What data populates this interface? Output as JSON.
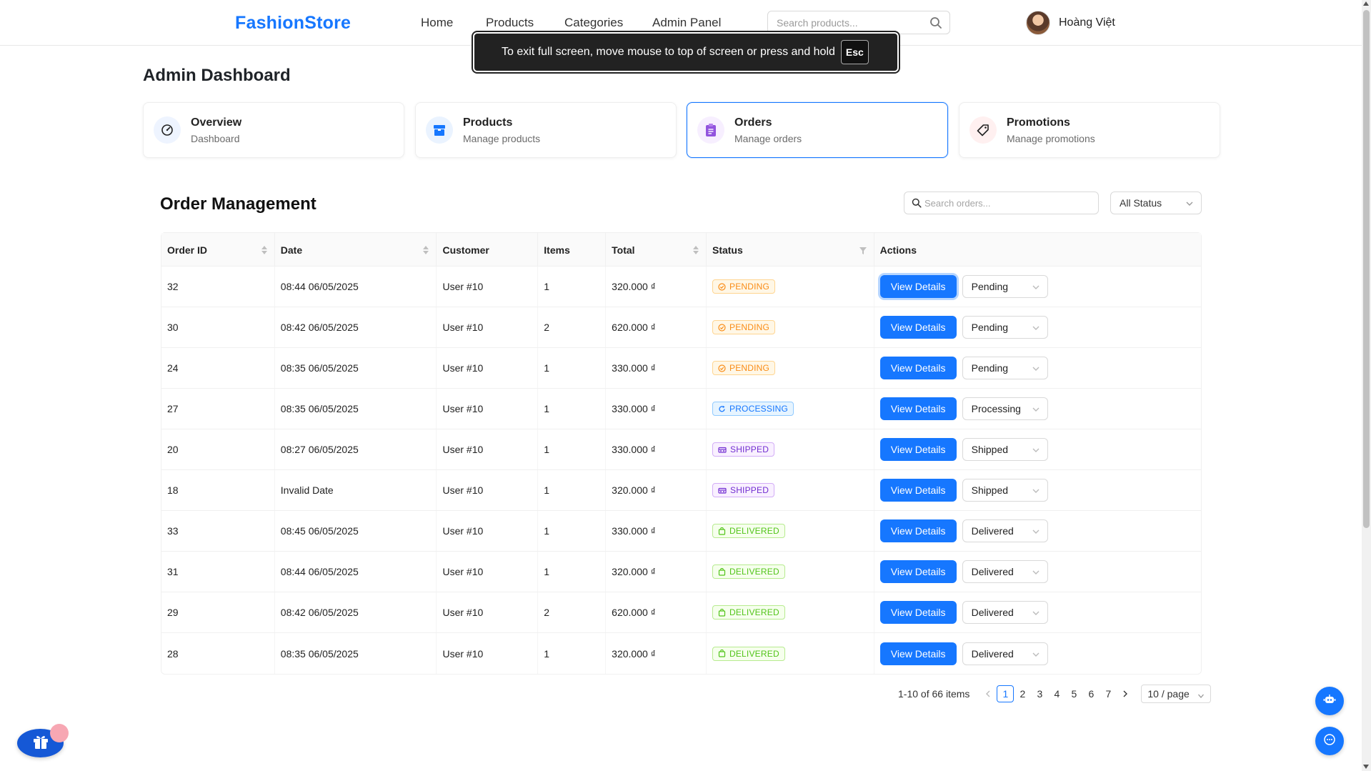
{
  "header": {
    "brand": "FashionStore",
    "nav": [
      "Home",
      "Products",
      "Categories",
      "Admin Panel"
    ],
    "search_placeholder": "Search products...",
    "user_name": "Hoàng Việt"
  },
  "fullscreen_toast": {
    "message": "To exit full screen, move mouse to top of screen or press and hold",
    "key": "Esc"
  },
  "page_title": "Admin Dashboard",
  "cards": [
    {
      "title": "Overview",
      "subtitle": "Dashboard",
      "icon": "dashboard-icon"
    },
    {
      "title": "Products",
      "subtitle": "Manage products",
      "icon": "box-icon"
    },
    {
      "title": "Orders",
      "subtitle": "Manage orders",
      "icon": "clipboard-icon",
      "active": true
    },
    {
      "title": "Promotions",
      "subtitle": "Manage promotions",
      "icon": "tag-icon"
    }
  ],
  "order_management": {
    "title": "Order Management",
    "search_placeholder": "Search orders...",
    "status_filter": "All Status",
    "columns": [
      "Order ID",
      "Date",
      "Customer",
      "Items",
      "Total",
      "Status",
      "Actions"
    ],
    "view_label": "View Details",
    "rows": [
      {
        "id": "32",
        "date": "08:44 06/05/2025",
        "customer": "User #10",
        "items": "1",
        "total": "320.000 ₫",
        "status": "PENDING",
        "status_key": "pending",
        "select": "Pending"
      },
      {
        "id": "30",
        "date": "08:42 06/05/2025",
        "customer": "User #10",
        "items": "2",
        "total": "620.000 ₫",
        "status": "PENDING",
        "status_key": "pending",
        "select": "Pending"
      },
      {
        "id": "24",
        "date": "08:35 06/05/2025",
        "customer": "User #10",
        "items": "1",
        "total": "330.000 ₫",
        "status": "PENDING",
        "status_key": "pending",
        "select": "Pending"
      },
      {
        "id": "27",
        "date": "08:35 06/05/2025",
        "customer": "User #10",
        "items": "1",
        "total": "330.000 ₫",
        "status": "PROCESSING",
        "status_key": "processing",
        "select": "Processing"
      },
      {
        "id": "20",
        "date": "08:27 06/05/2025",
        "customer": "User #10",
        "items": "1",
        "total": "330.000 ₫",
        "status": "SHIPPED",
        "status_key": "shipped",
        "select": "Shipped"
      },
      {
        "id": "18",
        "date": "Invalid Date",
        "customer": "User #10",
        "items": "1",
        "total": "320.000 ₫",
        "status": "SHIPPED",
        "status_key": "shipped",
        "select": "Shipped"
      },
      {
        "id": "33",
        "date": "08:45 06/05/2025",
        "customer": "User #10",
        "items": "1",
        "total": "330.000 ₫",
        "status": "DELIVERED",
        "status_key": "delivered",
        "select": "Delivered"
      },
      {
        "id": "31",
        "date": "08:44 06/05/2025",
        "customer": "User #10",
        "items": "1",
        "total": "320.000 ₫",
        "status": "DELIVERED",
        "status_key": "delivered",
        "select": "Delivered"
      },
      {
        "id": "29",
        "date": "08:42 06/05/2025",
        "customer": "User #10",
        "items": "2",
        "total": "620.000 ₫",
        "status": "DELIVERED",
        "status_key": "delivered",
        "select": "Delivered"
      },
      {
        "id": "28",
        "date": "08:35 06/05/2025",
        "customer": "User #10",
        "items": "1",
        "total": "320.000 ₫",
        "status": "DELIVERED",
        "status_key": "delivered",
        "select": "Delivered"
      }
    ]
  },
  "pagination": {
    "summary": "1-10 of 66 items",
    "pages": [
      "1",
      "2",
      "3",
      "4",
      "5",
      "6",
      "7"
    ],
    "current": "1",
    "page_size": "10 / page"
  },
  "colors": {
    "accent": "#1677ff",
    "pending": "#fa8c16",
    "processing": "#1677ff",
    "shipped": "#722ed1",
    "delivered": "#52c41a"
  }
}
